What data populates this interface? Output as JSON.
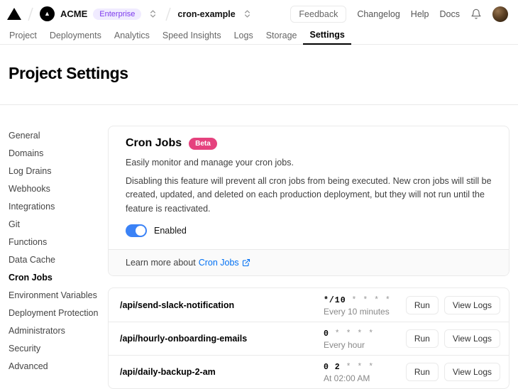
{
  "header": {
    "team_name": "ACME",
    "team_plan": "Enterprise",
    "project_name": "cron-example",
    "feedback_label": "Feedback",
    "links": {
      "changelog": "Changelog",
      "help": "Help",
      "docs": "Docs"
    }
  },
  "tabs": [
    {
      "label": "Project"
    },
    {
      "label": "Deployments"
    },
    {
      "label": "Analytics"
    },
    {
      "label": "Speed Insights"
    },
    {
      "label": "Logs"
    },
    {
      "label": "Storage"
    },
    {
      "label": "Settings"
    }
  ],
  "page_title": "Project Settings",
  "sidebar": {
    "items": [
      "General",
      "Domains",
      "Log Drains",
      "Webhooks",
      "Integrations",
      "Git",
      "Functions",
      "Data Cache",
      "Cron Jobs",
      "Environment Variables",
      "Deployment Protection",
      "Administrators",
      "Security",
      "Advanced"
    ],
    "active_item": "Cron Jobs"
  },
  "cron_card": {
    "title": "Cron Jobs",
    "badge": "Beta",
    "description": "Easily monitor and manage your cron jobs.",
    "disable_note": "Disabling this feature will prevent all cron jobs from being executed. New cron jobs will still be created, updated, and deleted on each production deployment, but they will not run until the feature is reactivated.",
    "toggle_label": "Enabled",
    "toggle_state": "on",
    "footer_text": "Learn more about",
    "footer_link": "Cron Jobs"
  },
  "cron_jobs": {
    "run_label": "Run",
    "view_logs_label": "View Logs",
    "rows": [
      {
        "path": "/api/send-slack-notification",
        "cron_value": "*/10",
        "cron_rest": " * * * *",
        "schedule": "Every 10 minutes"
      },
      {
        "path": "/api/hourly-onboarding-emails",
        "cron_value": "0",
        "cron_rest": " * * * *",
        "schedule": "Every hour"
      },
      {
        "path": "/api/daily-backup-2-am",
        "cron_value": "0 2",
        "cron_rest": " * * *",
        "schedule": "At 02:00 AM"
      }
    ]
  },
  "colors": {
    "accent_link_blue": "#0070f3",
    "toggle_blue": "#3b82f6",
    "beta_badge_pink": "#e5427e",
    "plan_badge_purple": "#7c3aed",
    "border_gray": "#eaeaea"
  }
}
